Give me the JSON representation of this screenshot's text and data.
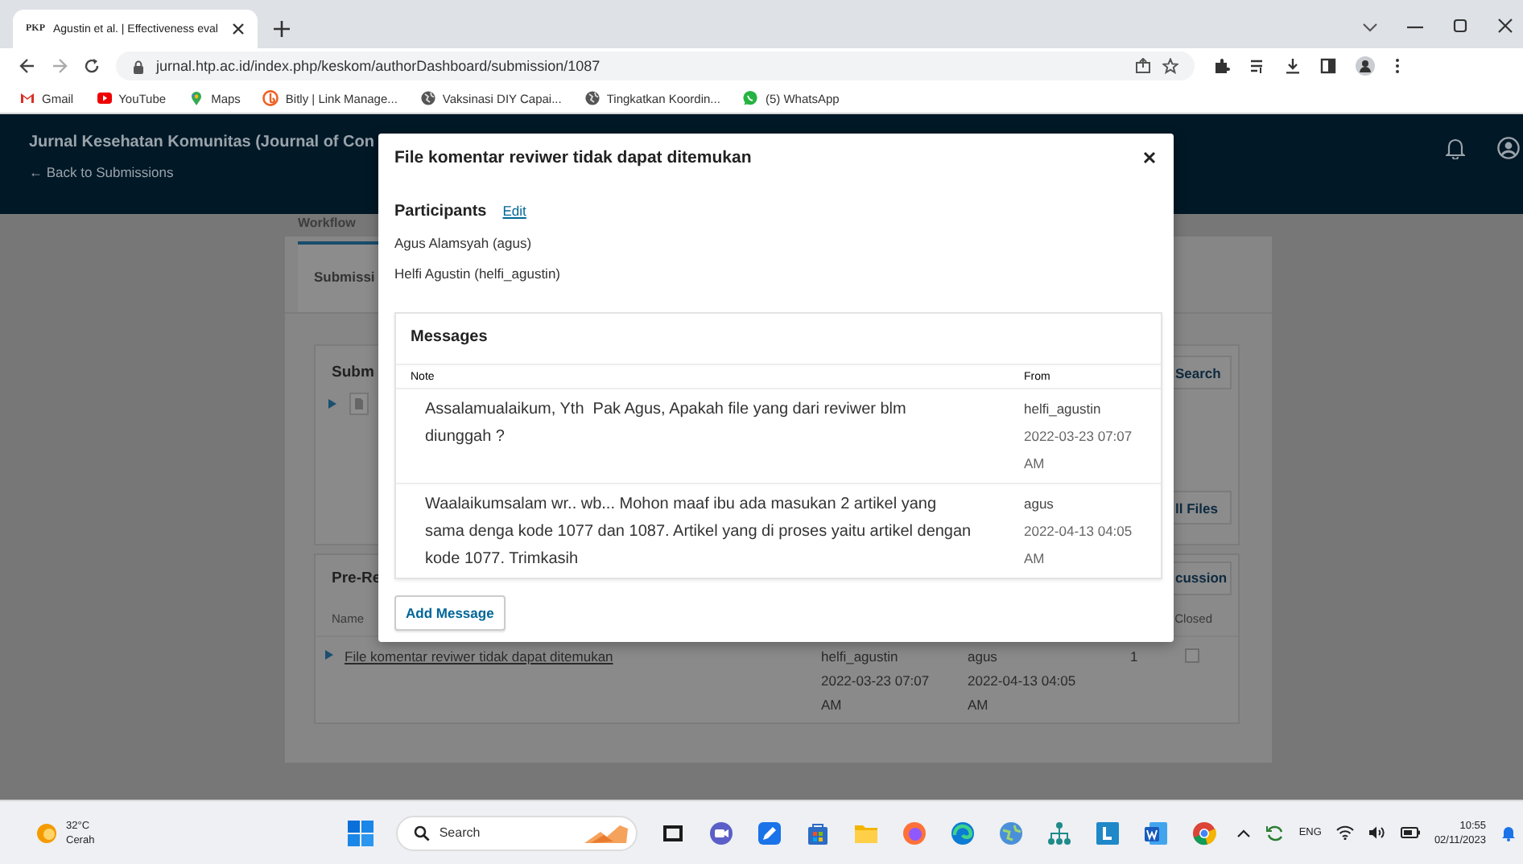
{
  "browser": {
    "tab": {
      "favicon_text": "PKP",
      "title": "Agustin et al. | Effectiveness eval"
    },
    "url": "jurnal.htp.ac.id/index.php/keskom/authorDashboard/submission/1087",
    "bookmarks": [
      {
        "kind": "mail",
        "label": "Gmail"
      },
      {
        "kind": "video",
        "label": "YouTube"
      },
      {
        "kind": "pin",
        "label": "Maps"
      },
      {
        "kind": "swirl",
        "label": "Bitly | Link Manage..."
      },
      {
        "kind": "globe",
        "label": "Vaksinasi DIY Capai..."
      },
      {
        "kind": "globe",
        "label": "Tingkatkan Koordin..."
      },
      {
        "kind": "chat",
        "label": "(5) WhatsApp"
      }
    ]
  },
  "header": {
    "journal_title": "Jurnal Kesehatan Komunitas (Journal of Con",
    "back_link": "← Back to Submissions"
  },
  "background": {
    "section_label": "Workflow",
    "tab": "Submissi",
    "files_card": {
      "title": "Subm",
      "buttons": [
        "Search",
        "ll Files"
      ]
    },
    "discussions_card": {
      "title": "Pre-Re",
      "button": "cussion",
      "columns": [
        "Name",
        "Closed"
      ],
      "rows": [
        {
          "name": "File komentar reviwer tidak dapat ditemukan",
          "from": "helfi_agustin",
          "from_date": "2022-03-23 07:07 AM",
          "last_reply": "agus",
          "reply_date": "2022-04-13 04:05 AM",
          "replies": "1",
          "closed": false
        }
      ]
    }
  },
  "modal": {
    "title": "File komentar reviwer tidak dapat ditemukan",
    "participants_label": "Participants",
    "edit_link": "Edit",
    "participants": [
      "Agus Alamsyah (agus)",
      "Helfi Agustin (helfi_agustin)"
    ],
    "messages": {
      "title": "Messages",
      "columns": [
        "Note",
        "From"
      ],
      "rows": [
        {
          "note": "Assalamualaikum, Yth  Pak Agus, Apakah file yang dari reviwer blm diunggah ?",
          "from": "helfi_agustin",
          "date": "2022-03-23 07:07 AM"
        },
        {
          "note": "Waalaikumsalam wr.. wb... Mohon maaf ibu ada masukan 2 artikel yang sama denga kode 1077 dan 1087. Artikel yang di proses yaitu artikel dengan kode 1077. Trimkasih",
          "from": "agus",
          "date": "2022-04-13 04:05 AM"
        }
      ]
    },
    "add_button": "Add Message"
  },
  "taskbar": {
    "weather": {
      "temperature": "32°C",
      "condition": "Cerah"
    },
    "search_placeholder": "Search",
    "language": "ENG",
    "time": "10:55",
    "date": "02/11/2023"
  }
}
